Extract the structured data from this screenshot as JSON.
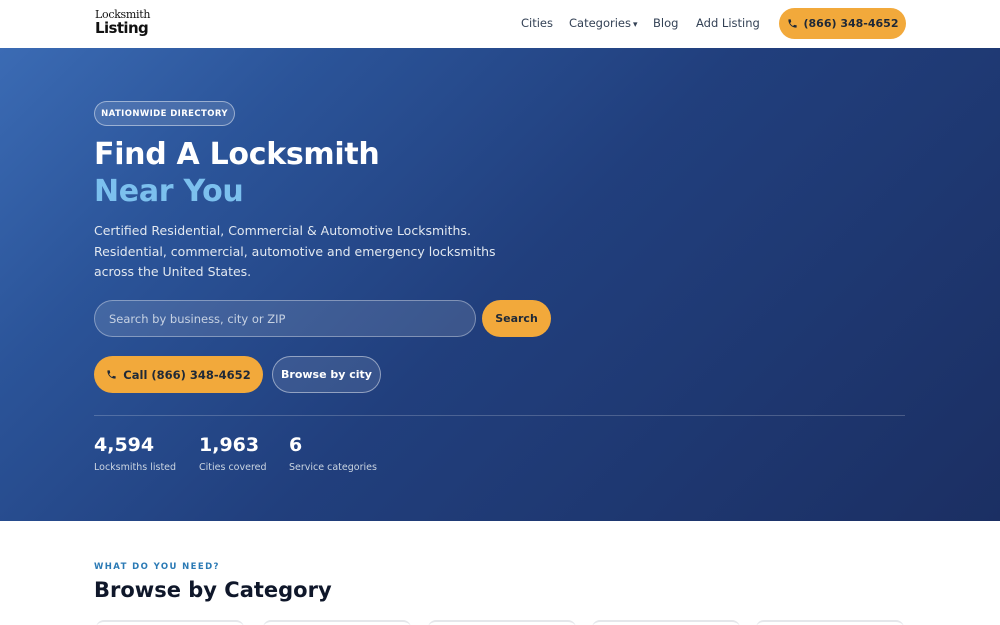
{
  "logo": {
    "line1": "Locksmith",
    "line2": "Listing"
  },
  "nav": {
    "cities": "Cities",
    "categories": "Categories",
    "blog": "Blog",
    "add_listing": "Add Listing",
    "phone": "(866) 348-4652"
  },
  "hero": {
    "badge": "NATIONWIDE DIRECTORY",
    "title_line1": "Find A Locksmith",
    "title_line2": "Near You",
    "description": "Certified Residential, Commercial & Automotive Locksmiths. Residential, commercial, automotive and emergency locksmiths across the United States.",
    "search_placeholder": "Search by business, city or ZIP",
    "search_button": "Search",
    "call_button": "Call (866) 348-4652",
    "browse_button": "Browse by city"
  },
  "stats": [
    {
      "value": "4,594",
      "label": "Locksmiths listed"
    },
    {
      "value": "1,963",
      "label": "Cities covered"
    },
    {
      "value": "6",
      "label": "Service categories"
    }
  ],
  "categories_section": {
    "eyebrow": "WHAT DO YOU NEED?",
    "title": "Browse by Category"
  },
  "icons": [
    "phone-icon",
    "chevron-down-icon"
  ],
  "colors": {
    "accent": "#f2a93b",
    "hero_gradient_start": "#3b6bb4",
    "hero_gradient_end": "#1b2f63",
    "highlight_text": "#7cc0ee",
    "eyebrow": "#2b7ab5"
  }
}
